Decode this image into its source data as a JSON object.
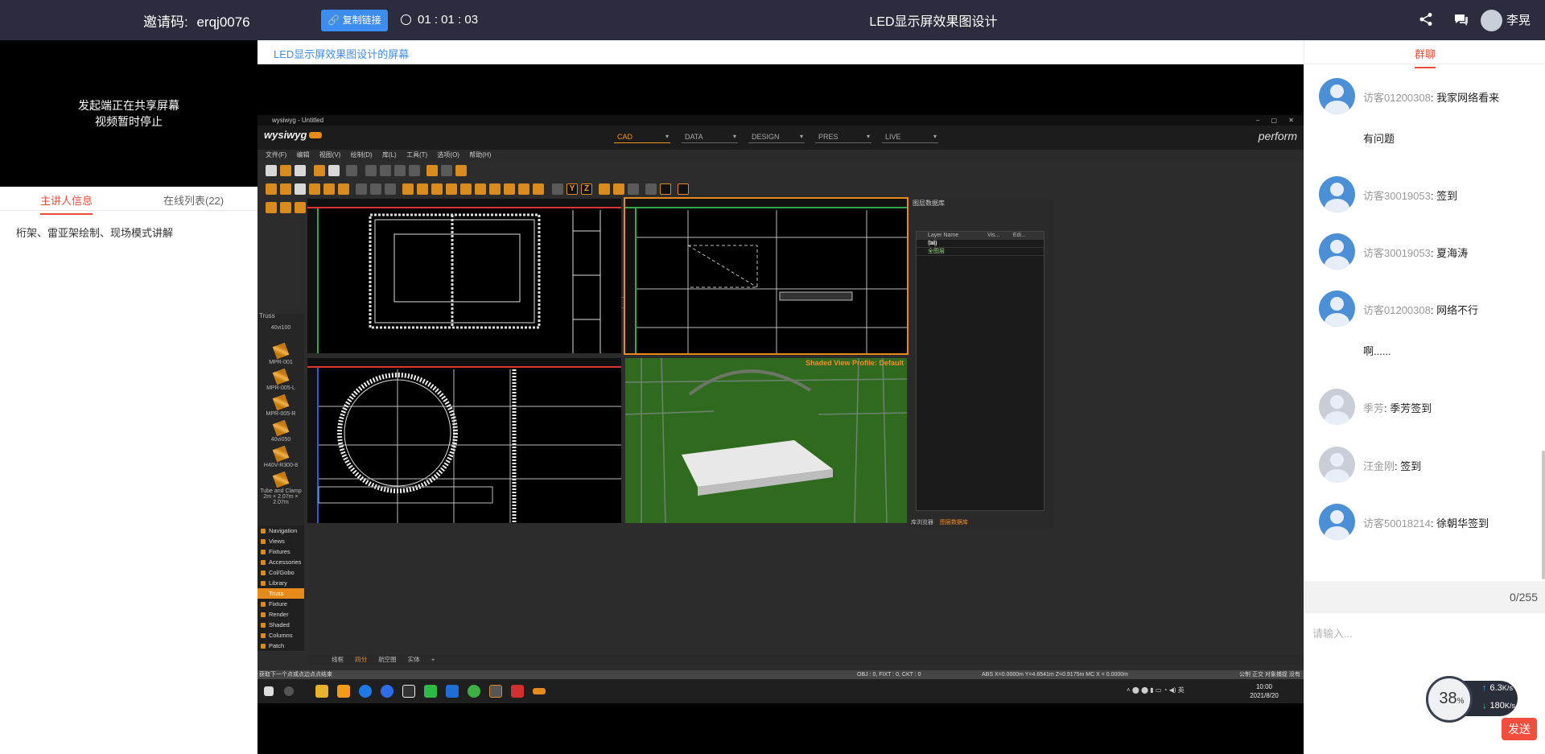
{
  "header": {
    "invite_label": "邀请码:",
    "invite_code": "erqj0076",
    "copy_link_label": "复制链接",
    "timer": "01 : 01 : 03",
    "title": "LED显示屏效果图设计",
    "user_name": "李晃",
    "share_icon": "share-icon",
    "chat_icon": "chat-bubble-icon"
  },
  "left": {
    "video_msg_line1": "发起端正在共享屏幕",
    "video_msg_line2": "视频暂时停止",
    "tabs": [
      "主讲人信息",
      "在线列表(22)"
    ],
    "host_info": "桁架、雷亚架绘制、现场模式讲解"
  },
  "share": {
    "title": "LED显示屏效果图设计的屏幕"
  },
  "app": {
    "window_title": "wysiwyg - Untitled",
    "brand": "wysiwyg",
    "modes": [
      "CAD",
      "DATA",
      "DESIGN",
      "PRES",
      "LIVE"
    ],
    "perform": "perform",
    "menu": [
      "文件(F)",
      "编辑",
      "视图(V)",
      "绘制(D)",
      "库(L)",
      "工具(T)",
      "选项(O)",
      "帮助(H)"
    ],
    "panel_title": "Truss",
    "library_items": [
      "40vi100",
      "MPR-001",
      "MPR-005-L",
      "MPR-005-R",
      "40vi050",
      "H40V-R300-8",
      "Tube and Clamp 2m × 2.07m × 2.07m"
    ],
    "categories": [
      "Navigation",
      "Views",
      "Fixtures",
      "Accessories",
      "Col/Gobo",
      "Library",
      "Truss",
      "Fixture Groups",
      "Render",
      "Shaded View...",
      "Columns",
      "Patch"
    ],
    "active_category": "Truss",
    "shaded_profile": "Shaded View Profile: Default",
    "layers_title": "图层数据库",
    "layers_columns": [
      "Layer Name",
      "Vis...",
      "Edi...",
      "Tag"
    ],
    "layers_rows": [
      "(all)",
      "全图层"
    ],
    "layers_bottom_tabs": [
      "库浏览器",
      "图层数据库"
    ],
    "bottom_tabs": [
      "线框",
      "四分",
      "航空图",
      "实体",
      "+"
    ],
    "active_bottom_tab": "四分",
    "status_left": "获取下一个点或点边点点结束",
    "status_mid": "OBJ : 0, FIXT : 0, CKT : 0",
    "status_coords": "ABS    X=0.0000m    Y=4.6541m    Z=0.9175m    MC  X = 0.0000m",
    "status_right": "公制  正交  对象捕捉  没有捕捉",
    "clock_time": "10:00",
    "clock_date": "2021/8/20",
    "ime": "英"
  },
  "chat": {
    "tab": "群聊",
    "messages": [
      {
        "user": "访客01200308",
        "text": "我家网络看来",
        "cont": "有问题",
        "avatar": "blue"
      },
      {
        "user": "访客30019053",
        "text": "签到",
        "cont": "",
        "avatar": "blue"
      },
      {
        "user": "访客30019053",
        "text": "夏海涛",
        "cont": "",
        "avatar": "blue"
      },
      {
        "user": "访客01200308",
        "text": "网络不行",
        "cont": "啊......",
        "avatar": "blue"
      },
      {
        "user": "季芳",
        "text": "季芳签到",
        "cont": "",
        "avatar": "gray"
      },
      {
        "user": "汪金刚",
        "text": "签到",
        "cont": "",
        "avatar": "gray"
      },
      {
        "user": "访客50018214",
        "text": "徐朝华签到",
        "cont": "",
        "avatar": "blue"
      }
    ],
    "counter": "0/255",
    "placeholder": "请输入...",
    "send_label": "发送"
  },
  "speed": {
    "percent": "38",
    "percent_unit": "%",
    "upload": "6.3",
    "download": "180",
    "unit": "K/s"
  },
  "colors": {
    "topbar_bg": "#2b2c3e",
    "accent_red": "#f04b3a",
    "accent_blue": "#3d8cf0",
    "wysiwyg_orange": "#e68a1c"
  }
}
